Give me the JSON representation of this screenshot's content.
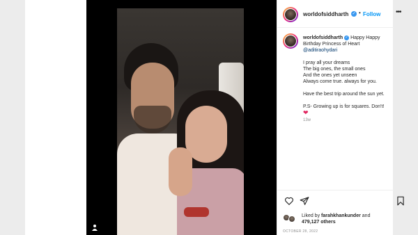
{
  "header": {
    "username": "worldofsiddharth",
    "follow_label": "Follow",
    "more_label": "•••"
  },
  "caption": {
    "username": "worldofsiddharth",
    "line1": "Happy Happy Birthday Princess of Heart",
    "mention": "@aditiraohydari",
    "para1": [
      "I pray all your dreams",
      "The big ones, the small ones",
      "And the ones yet unseen",
      "Always come true. always for you."
    ],
    "para2": "Have the best trip around the sun yet.",
    "para3": "P.S- Growing up is for squares. Don't!",
    "time_ago": "13w"
  },
  "likes": {
    "prefix": "Liked by",
    "name": "farahkhankunder",
    "conj": "and",
    "count": "479,127 others"
  },
  "post_date": "OCTOBER 28, 2022",
  "icons": [
    "reel-icon",
    "like-icon",
    "share-icon",
    "save-icon",
    "verified-badge-icon"
  ]
}
